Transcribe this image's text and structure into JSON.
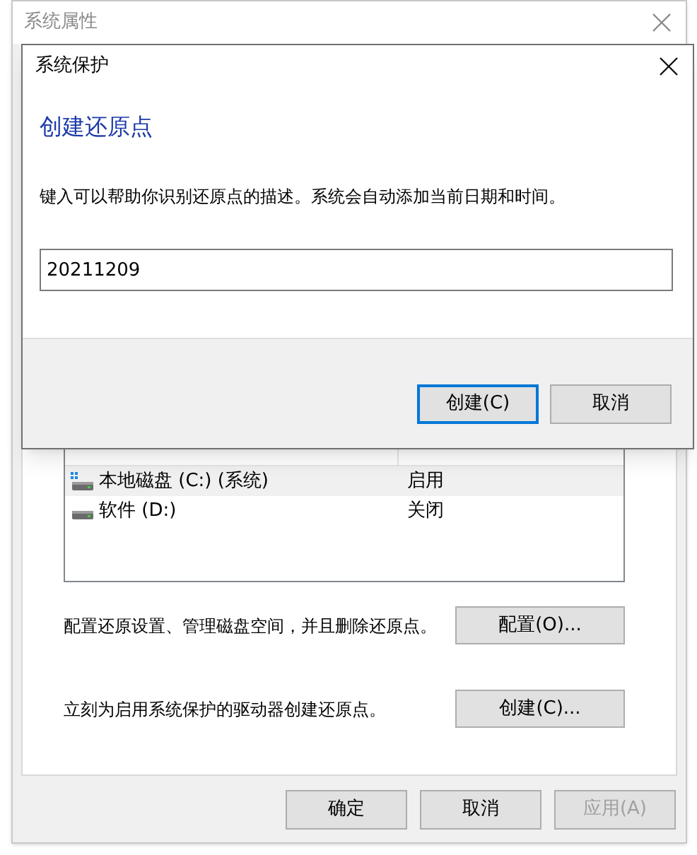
{
  "background_window": {
    "title": "系统属性",
    "list": {
      "rows": [
        {
          "drive": "本地磁盘 (C:) (系统)",
          "protection": "启用",
          "system": true,
          "selected": true
        },
        {
          "drive": "软件 (D:)",
          "protection": "关闭",
          "system": false,
          "selected": false
        }
      ]
    },
    "actions": [
      {
        "description": "配置还原设置、管理磁盘空间，并且删除还原点。",
        "button": "配置(O)..."
      },
      {
        "description": "立刻为启用系统保护的驱动器创建还原点。",
        "button": "创建(C)..."
      }
    ],
    "buttons": [
      {
        "label": "确定",
        "disabled": false
      },
      {
        "label": "取消",
        "disabled": false
      },
      {
        "label": "应用(A)",
        "disabled": true
      }
    ]
  },
  "dialog": {
    "title": "系统保护",
    "heading": "创建还原点",
    "description": "键入可以帮助你识别还原点的描述。系统会自动添加当前日期和时间。",
    "input": {
      "value": "20211209"
    },
    "buttons": [
      {
        "label": "创建(C)",
        "default": true
      },
      {
        "label": "取消",
        "default": false
      }
    ]
  }
}
